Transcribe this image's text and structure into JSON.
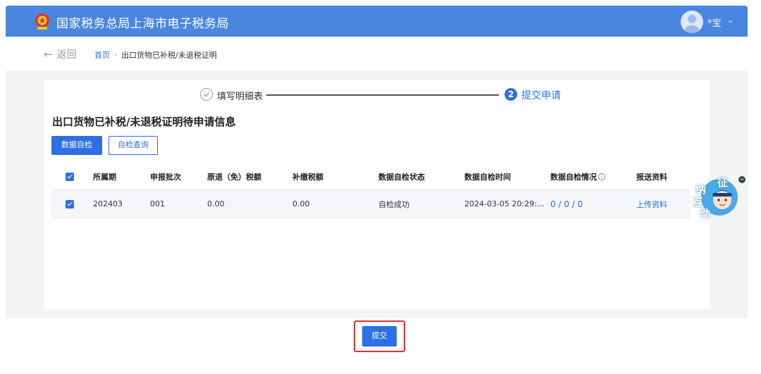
{
  "header": {
    "site_title": "国家税务总局上海市电子税务局",
    "user_name": "*宝",
    "caret": "⌄"
  },
  "nav": {
    "back_label": "返回",
    "breadcrumb": {
      "home": "首页",
      "separator": "›",
      "current": "出口货物已补税/未退税证明"
    }
  },
  "steps": [
    {
      "label": "填写明细表",
      "state": "done"
    },
    {
      "number": "2",
      "label": "提交申请",
      "state": "active"
    }
  ],
  "section_title": "出口货物已补税/未退税证明待申请信息",
  "toolbar": {
    "self_check": "数据自检",
    "self_check_query": "自检查询"
  },
  "table": {
    "columns": [
      "所属期",
      "申报批次",
      "原退（免）税额",
      "补缴税额",
      "数据自检状态",
      "数据自检时间",
      "数据自检情况",
      "报送资料"
    ],
    "rows": [
      {
        "period": "202403",
        "batch": "001",
        "original_refund": "0.00",
        "supplement_tax": "0.00",
        "check_status": "自检成功",
        "check_time": "2024-03-05 20:29:...",
        "check_result": "0 / 0 / 0",
        "attachment": "上传资料"
      }
    ]
  },
  "footer": {
    "submit_label": "提交"
  },
  "widget": {
    "chars": [
      "征",
      "纳",
      "互",
      "动"
    ]
  },
  "colors": {
    "primary": "#2f6fe4",
    "header_bg": "#4a86e0",
    "highlight": "#e03030"
  }
}
